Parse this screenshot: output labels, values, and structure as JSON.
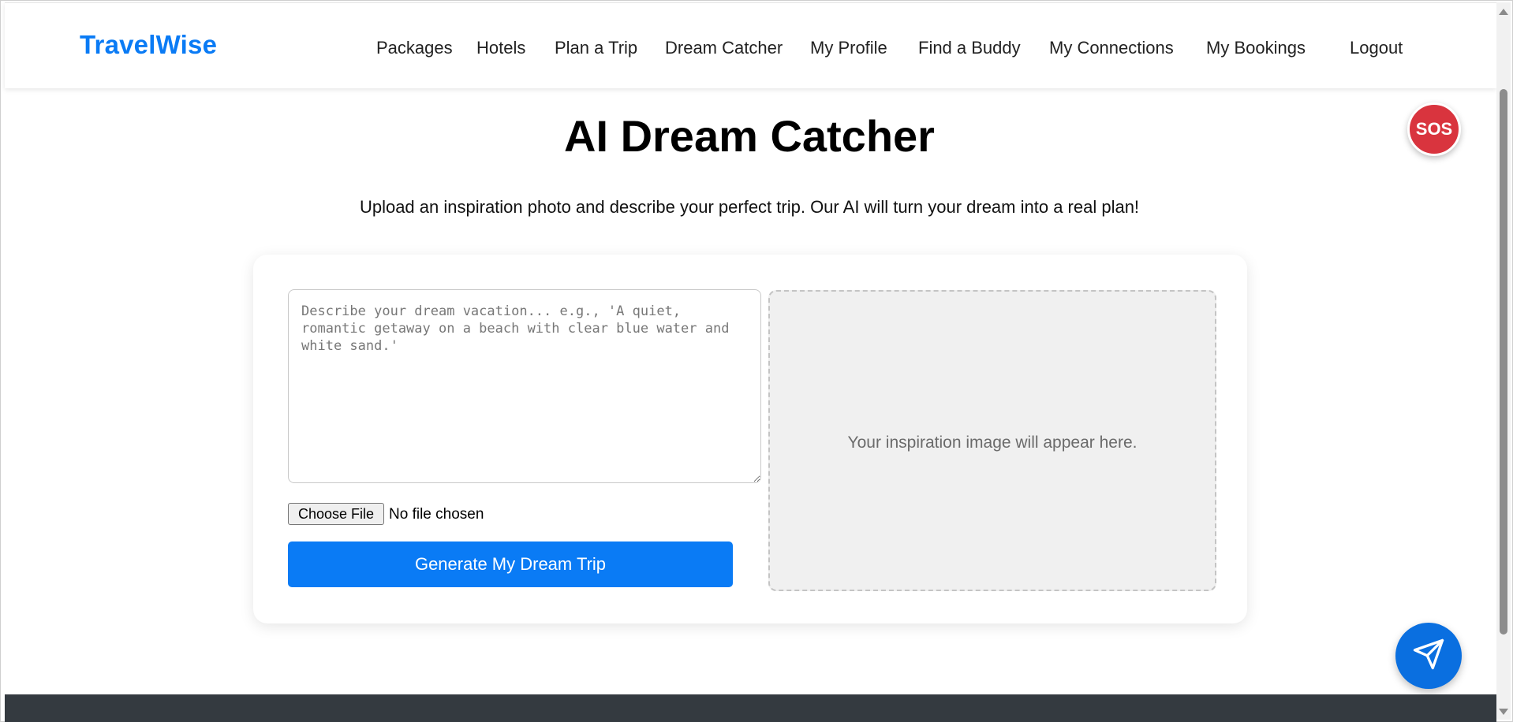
{
  "nav": {
    "brand": "TravelWise",
    "links": [
      {
        "label": "Packages"
      },
      {
        "label": "Hotels"
      },
      {
        "label": "Plan a Trip"
      },
      {
        "label": "Dream Catcher"
      },
      {
        "label": "My Profile"
      },
      {
        "label": "Find a Buddy"
      },
      {
        "label": "My Connections"
      },
      {
        "label": "My Bookings"
      },
      {
        "label": "Logout"
      }
    ]
  },
  "main": {
    "title": "AI Dream Catcher",
    "subtitle": "Upload an inspiration photo and describe your perfect trip. Our AI will turn your dream into a real plan!",
    "form": {
      "description_value": "",
      "description_placeholder": "Describe your dream vacation... e.g., 'A quiet, romantic getaway on a beach with clear blue water and white sand.'",
      "choose_file_label": "Choose File",
      "file_status": "No file chosen",
      "generate_label": "Generate My Dream Trip"
    },
    "preview": {
      "placeholder_text": "Your inspiration image will appear here."
    }
  },
  "floating": {
    "sos_label": "SOS",
    "send_icon": "paper-plane-icon"
  },
  "colors": {
    "brand": "#0a7bf5",
    "primary_button": "#0a7bf5",
    "sos": "#d9343e",
    "footer": "#343a40"
  }
}
